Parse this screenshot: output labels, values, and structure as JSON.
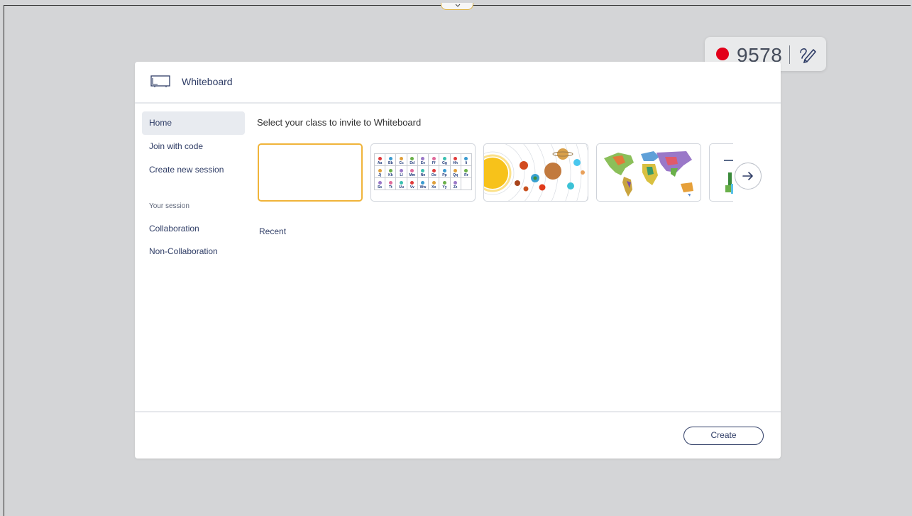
{
  "recording": {
    "code": "9578",
    "dot_color": "#e2001a",
    "pen_icon": "pen-icon"
  },
  "dialog": {
    "title": "Whiteboard",
    "icon": "whiteboard-icon"
  },
  "sidebar": {
    "items": [
      {
        "label": "Home",
        "active": true
      },
      {
        "label": "Join with code"
      },
      {
        "label": "Create new session"
      }
    ],
    "section_heading": "Your session",
    "session_items": [
      {
        "label": "Collaboration"
      },
      {
        "label": "Non-Collaboration"
      }
    ]
  },
  "main": {
    "heading": "Select your class to invite to Whiteboard",
    "templates": [
      {
        "name": "blank",
        "selected": true
      },
      {
        "name": "alphabet-chart",
        "letters": [
          "Aa",
          "Bb",
          "Cc",
          "Dd",
          "Ee",
          "Ff",
          "Gg",
          "Hh",
          "Ii",
          "Jj",
          "Kk",
          "Ll",
          "Mm",
          "Nn",
          "Oo",
          "Pp",
          "Qq",
          "Rr",
          "Ss",
          "Tt",
          "Uu",
          "Vv",
          "Ww",
          "Xx",
          "Yy",
          "Zz"
        ]
      },
      {
        "name": "solar-system"
      },
      {
        "name": "world-map"
      },
      {
        "name": "partial-template"
      }
    ],
    "next_icon": "arrow-right-icon",
    "recent_label": "Recent"
  },
  "footer": {
    "create_label": "Create"
  },
  "colors": {
    "accent": "#2f3d66",
    "selection": "#f0b43a"
  }
}
